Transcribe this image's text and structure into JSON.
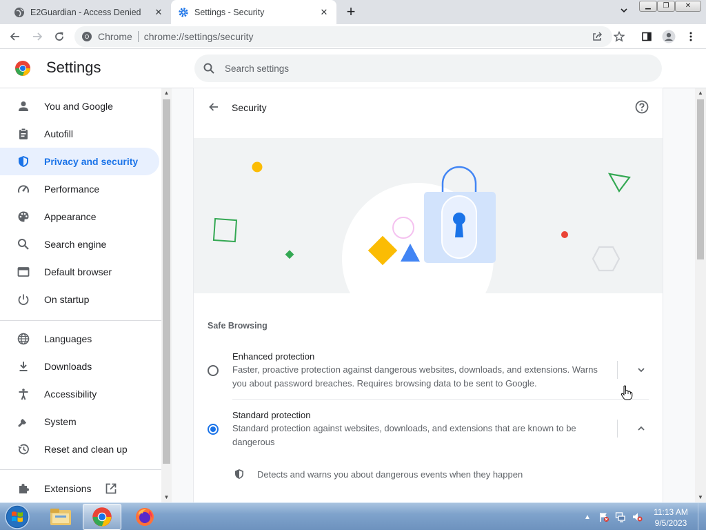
{
  "browser": {
    "tabs": [
      {
        "title": "E2Guardian - Access Denied"
      },
      {
        "title": "Settings - Security"
      }
    ],
    "omnibox": {
      "site_label": "Chrome",
      "url": "chrome://settings/security"
    }
  },
  "settings": {
    "title": "Settings",
    "search_placeholder": "Search settings"
  },
  "sidebar": {
    "items": [
      {
        "label": "You and Google",
        "icon": "person-icon"
      },
      {
        "label": "Autofill",
        "icon": "clipboard-icon"
      },
      {
        "label": "Privacy and security",
        "icon": "shield-icon",
        "active": true
      },
      {
        "label": "Performance",
        "icon": "speedometer-icon"
      },
      {
        "label": "Appearance",
        "icon": "palette-icon"
      },
      {
        "label": "Search engine",
        "icon": "search-icon"
      },
      {
        "label": "Default browser",
        "icon": "browser-window-icon"
      },
      {
        "label": "On startup",
        "icon": "power-icon"
      },
      {
        "label": "Languages",
        "icon": "globe-icon"
      },
      {
        "label": "Downloads",
        "icon": "download-icon"
      },
      {
        "label": "Accessibility",
        "icon": "accessibility-icon"
      },
      {
        "label": "System",
        "icon": "wrench-icon"
      },
      {
        "label": "Reset and clean up",
        "icon": "history-icon"
      },
      {
        "label": "Extensions",
        "icon": "puzzle-icon"
      }
    ]
  },
  "security": {
    "page_title": "Security",
    "section_title": "Safe Browsing",
    "options": [
      {
        "label": "Enhanced protection",
        "description": "Faster, proactive protection against dangerous websites, downloads, and extensions. Warns you about password breaches. Requires browsing data to be sent to Google.",
        "selected": false,
        "expanded": false
      },
      {
        "label": "Standard protection",
        "description": "Standard protection against websites, downloads, and extensions that are known to be dangerous",
        "selected": true,
        "expanded": true
      }
    ],
    "standard_details": [
      {
        "text": "Detects and warns you about dangerous events when they happen",
        "icon": "shield-icon"
      }
    ]
  },
  "taskbar": {
    "time": "11:13 AM",
    "date": "9/5/2023",
    "apps": [
      "file-explorer-icon",
      "chrome-icon",
      "firefox-icon"
    ]
  },
  "colors": {
    "accent": "#1a73e8",
    "active_nav_bg": "#e8f0fe",
    "tab_strip": "#dee1e6"
  }
}
